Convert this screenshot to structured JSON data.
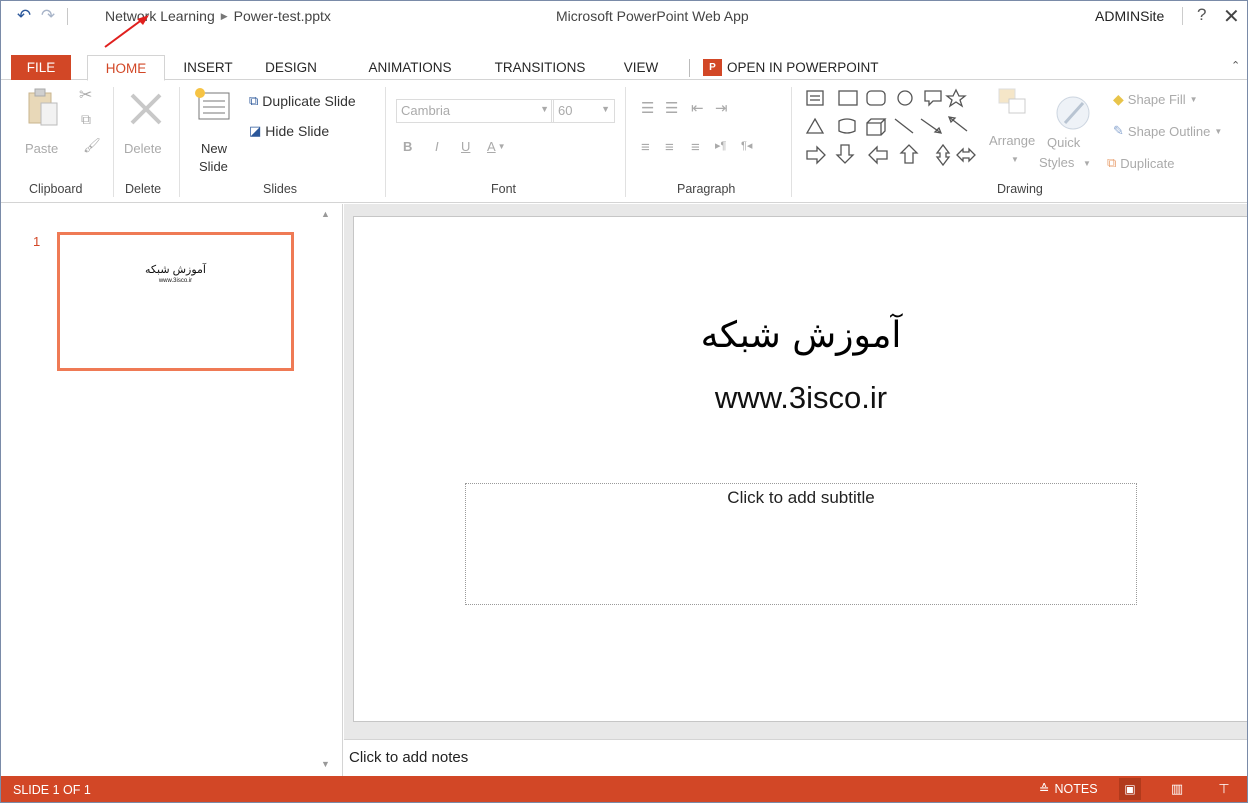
{
  "window": {
    "breadcrumb": [
      "Network Learning",
      "Power-test.pptx"
    ],
    "app_title": "Microsoft PowerPoint Web App",
    "user": "ADMINSite",
    "help": "?",
    "close": "✕"
  },
  "tabs": {
    "file": "FILE",
    "home": "HOME",
    "insert": "INSERT",
    "design": "DESIGN",
    "animations": "ANIMATIONS",
    "transitions": "TRANSITIONS",
    "view": "VIEW",
    "open_in": "OPEN IN POWERPOINT",
    "open_badge": "P"
  },
  "ribbon": {
    "clipboard": {
      "paste": "Paste",
      "label": "Clipboard"
    },
    "delete": {
      "delete": "Delete",
      "label": "Delete"
    },
    "slides": {
      "new_slide_1": "New",
      "new_slide_2": "Slide",
      "duplicate": "Duplicate Slide",
      "hide": "Hide Slide",
      "label": "Slides"
    },
    "font": {
      "family": "Cambria",
      "size": "60",
      "bold": "B",
      "italic": "I",
      "underline": "U",
      "color": "A",
      "label": "Font"
    },
    "paragraph": {
      "label": "Paragraph"
    },
    "drawing": {
      "arrange": "Arrange",
      "quick_1": "Quick",
      "quick_2": "Styles",
      "shape_fill": "Shape Fill",
      "shape_outline": "Shape Outline",
      "duplicate": "Duplicate",
      "label": "Drawing"
    }
  },
  "thumbnails": [
    {
      "number": "1",
      "title": "آموزش شبکه",
      "subtitle": "www.3isco.ir"
    }
  ],
  "slide": {
    "title": "آموزش شبکه",
    "url": "www.3isco.ir",
    "subtitle_placeholder": "Click to add subtitle"
  },
  "notes": {
    "placeholder": "Click to add notes"
  },
  "status": {
    "slide_count": "SLIDE 1 OF 1",
    "notes_button": "NOTES"
  },
  "colors": {
    "accent": "#d24726",
    "selection": "#ef7a55"
  },
  "icons": [
    "undo-icon",
    "redo-icon",
    "paste-icon",
    "cut-icon",
    "copy-icon",
    "format-painter-icon",
    "delete-icon",
    "new-slide-icon",
    "duplicate-slide-icon",
    "hide-slide-icon",
    "bullets-icon",
    "numbering-icon",
    "shape-fill-icon",
    "shape-outline-icon",
    "notes-icon",
    "normal-view-icon",
    "reading-view-icon",
    "slideshow-icon"
  ]
}
